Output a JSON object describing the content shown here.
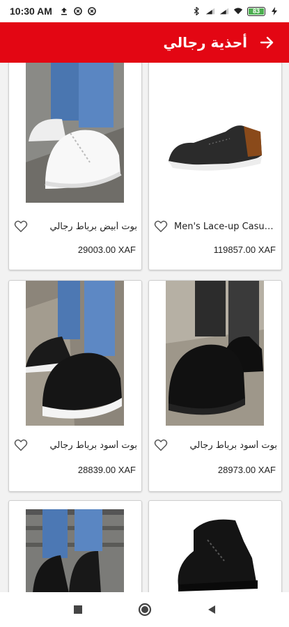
{
  "status_bar": {
    "time": "10:30 AM",
    "battery": "83"
  },
  "app_bar": {
    "title": "أحذية رجالي"
  },
  "products": [
    {
      "name": "بوت أبيض برباط رجالي",
      "price": "29003.00 XAF",
      "image": "white-sneaker-photo"
    },
    {
      "name": "Men's Lace-up Casual Shoes",
      "price": "119857.00 XAF",
      "image": "black-trainer-photo"
    },
    {
      "name": "بوت أسود برباط رجالي",
      "price": "28839.00 XAF",
      "image": "black-white-sole-boot-photo"
    },
    {
      "name": "بوت أسود برباط رجالي",
      "price": "28973.00 XAF",
      "image": "all-black-boot-photo"
    },
    {
      "name": "",
      "price": "",
      "image": "black-boot-stairs-photo"
    },
    {
      "name": "",
      "price": "",
      "image": "black-high-top-photo"
    }
  ],
  "colors": {
    "accent": "#e30613"
  }
}
